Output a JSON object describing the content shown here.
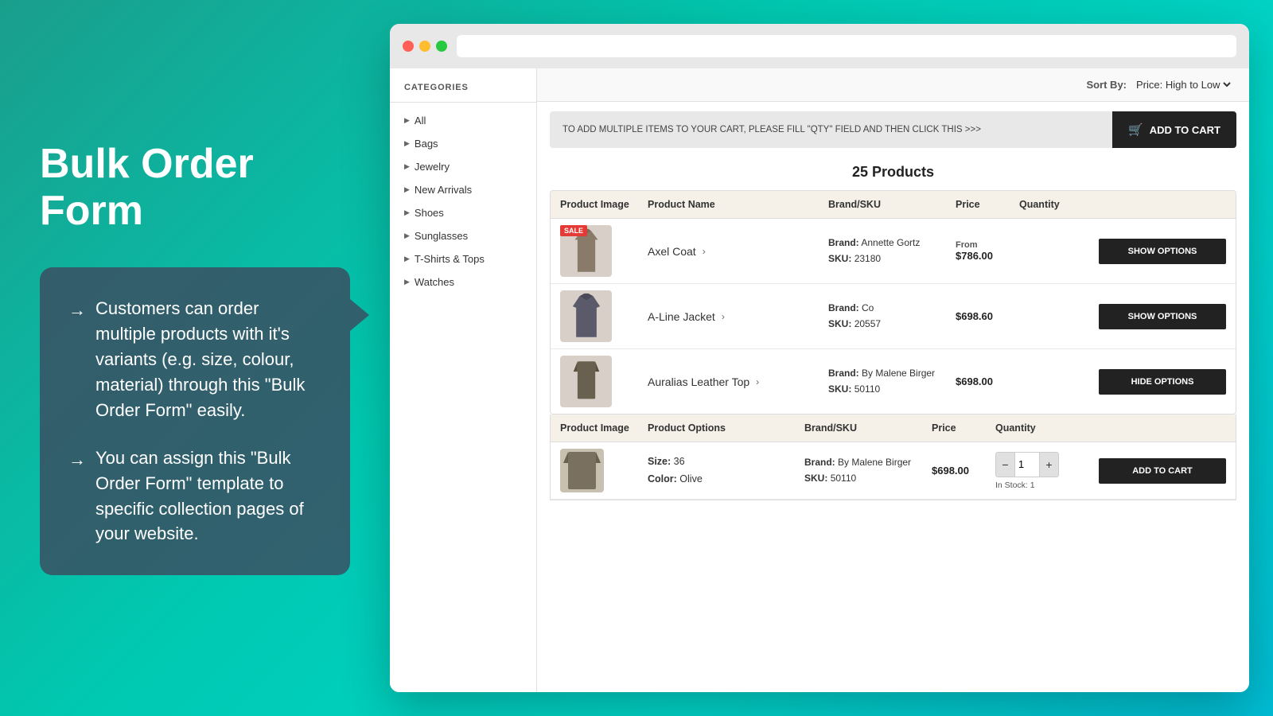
{
  "left": {
    "title": "Bulk Order Form",
    "points": [
      "Customers can order multiple products with it's variants (e.g. size, colour, material) through this \"Bulk Order Form\" easily.",
      "You can assign this \"Bulk Order Form\" template to specific collection pages of your website."
    ]
  },
  "browser": {
    "sort": {
      "label": "Sort By:",
      "value": "Price: High to Low"
    },
    "add_bar": {
      "text": "TO ADD MULTIPLE ITEMS TO YOUR CART, PLEASE FILL \"QTY\" FIELD AND THEN CLICK THIS >>>",
      "button": "ADD TO CART"
    },
    "products_count": "25 Products",
    "sidebar": {
      "title": "CATEGORIES",
      "items": [
        "All",
        "Bags",
        "Jewelry",
        "New Arrivals",
        "Shoes",
        "Sunglasses",
        "T-Shirts & Tops",
        "Watches"
      ]
    },
    "table_headers": [
      "Product Image",
      "Product Name",
      "Brand/SKU",
      "Price",
      "Quantity",
      ""
    ],
    "products": [
      {
        "name": "Axel Coat",
        "brand": "Annette Gortz",
        "sku": "23180",
        "price": "From\n$786.00",
        "sale": true,
        "action": "SHOW OPTIONS",
        "type": "coat"
      },
      {
        "name": "A-Line Jacket",
        "brand": "Co",
        "sku": "20557",
        "price": "$698.60",
        "sale": false,
        "action": "SHOW OPTIONS",
        "type": "jacket"
      },
      {
        "name": "Auralias Leather Top",
        "brand": "By Malene Birger",
        "sku": "50110",
        "price": "$698.00",
        "sale": false,
        "action": "HIDE OPTIONS",
        "type": "top"
      }
    ],
    "options_headers": [
      "Product Image",
      "Product Options",
      "Brand/SKU",
      "Price",
      "Quantity",
      ""
    ],
    "options": [
      {
        "size": "36",
        "color": "Olive",
        "brand": "By Malene Birger",
        "sku": "50110",
        "price": "$698.00",
        "qty": "1",
        "in_stock": "In Stock: 1",
        "action": "ADD TO CART",
        "type": "top"
      }
    ]
  }
}
